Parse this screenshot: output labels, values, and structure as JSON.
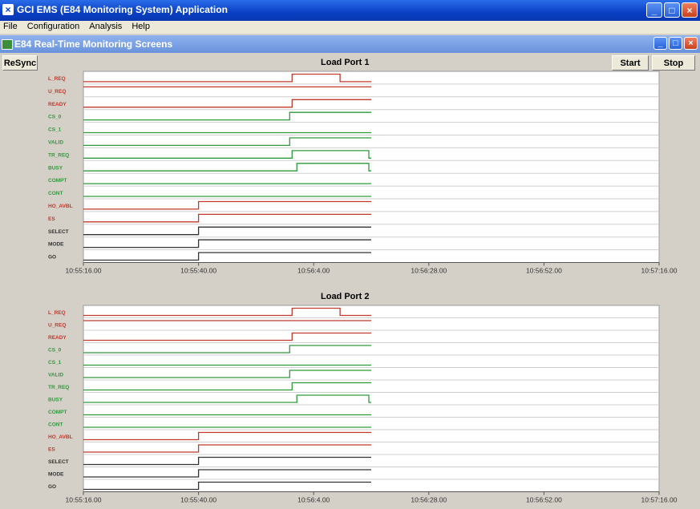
{
  "app": {
    "title": "GCI EMS (E84 Monitoring System) Application",
    "menu": [
      "File",
      "Configuration",
      "Analysis",
      "Help"
    ]
  },
  "child_window": {
    "title": "E84 Real-Time Monitoring Screens"
  },
  "toolbar": {
    "resync_label": "ReSync",
    "start_label": "Start",
    "stop_label": "Stop"
  },
  "colors": {
    "red": "#c0392b",
    "green": "#2e9a3a",
    "black": "#333333",
    "bg": "#d4d0c8"
  },
  "signals": [
    {
      "name": "L_REQ",
      "color": "red"
    },
    {
      "name": "U_REQ",
      "color": "red"
    },
    {
      "name": "READY",
      "color": "red"
    },
    {
      "name": "CS_0",
      "color": "green"
    },
    {
      "name": "CS_1",
      "color": "green"
    },
    {
      "name": "VALID",
      "color": "green"
    },
    {
      "name": "TR_REQ",
      "color": "green"
    },
    {
      "name": "BUSY",
      "color": "green"
    },
    {
      "name": "COMPT",
      "color": "green"
    },
    {
      "name": "CONT",
      "color": "green"
    },
    {
      "name": "HO_AVBL",
      "color": "red"
    },
    {
      "name": "ES",
      "color": "red"
    },
    {
      "name": "SELECT",
      "color": "black"
    },
    {
      "name": "MODE",
      "color": "black"
    },
    {
      "name": "GO",
      "color": "black"
    }
  ],
  "time_axis": {
    "ticks": [
      "10:55:16.00",
      "10:55:40.00",
      "10:56:4.00",
      "10:56:28.00",
      "10:56:52.00",
      "10:57:16.00"
    ],
    "start_seconds": 0,
    "end_seconds": 120,
    "data_end_seconds": 60
  },
  "chart_data": [
    {
      "type": "timing",
      "title": "Load Port 1",
      "x_range": [
        "10:55:16.00",
        "10:57:16.00"
      ],
      "series": [
        {
          "name": "L_REQ",
          "transitions": [
            [
              0,
              0
            ],
            [
              43.5,
              1
            ],
            [
              53.5,
              0
            ]
          ]
        },
        {
          "name": "U_REQ",
          "transitions": [
            [
              0,
              1
            ]
          ]
        },
        {
          "name": "READY",
          "transitions": [
            [
              0,
              0
            ],
            [
              43.5,
              1
            ]
          ]
        },
        {
          "name": "CS_0",
          "transitions": [
            [
              0,
              0
            ],
            [
              43,
              1
            ]
          ]
        },
        {
          "name": "CS_1",
          "transitions": [
            [
              0,
              0
            ]
          ]
        },
        {
          "name": "VALID",
          "transitions": [
            [
              0,
              0
            ],
            [
              43,
              1
            ]
          ]
        },
        {
          "name": "TR_REQ",
          "transitions": [
            [
              0,
              0
            ],
            [
              43.5,
              1
            ],
            [
              59.5,
              0
            ]
          ]
        },
        {
          "name": "BUSY",
          "transitions": [
            [
              0,
              0
            ],
            [
              44.5,
              1
            ],
            [
              59.5,
              0
            ]
          ]
        },
        {
          "name": "COMPT",
          "transitions": [
            [
              0,
              0
            ]
          ]
        },
        {
          "name": "CONT",
          "transitions": [
            [
              0,
              0
            ]
          ]
        },
        {
          "name": "HO_AVBL",
          "transitions": [
            [
              0,
              0
            ],
            [
              24,
              1
            ]
          ]
        },
        {
          "name": "ES",
          "transitions": [
            [
              0,
              0
            ],
            [
              24,
              1
            ]
          ]
        },
        {
          "name": "SELECT",
          "transitions": [
            [
              0,
              0
            ],
            [
              24,
              1
            ]
          ]
        },
        {
          "name": "MODE",
          "transitions": [
            [
              0,
              0
            ],
            [
              24,
              1
            ]
          ]
        },
        {
          "name": "GO",
          "transitions": [
            [
              0,
              0
            ],
            [
              24,
              1
            ]
          ]
        }
      ]
    },
    {
      "type": "timing",
      "title": "Load Port 2",
      "x_range": [
        "10:55:16.00",
        "10:57:16.00"
      ],
      "series": [
        {
          "name": "L_REQ",
          "transitions": [
            [
              0,
              0
            ],
            [
              43.5,
              1
            ],
            [
              53.5,
              0
            ]
          ]
        },
        {
          "name": "U_REQ",
          "transitions": [
            [
              0,
              1
            ]
          ]
        },
        {
          "name": "READY",
          "transitions": [
            [
              0,
              0
            ],
            [
              43.5,
              1
            ]
          ]
        },
        {
          "name": "CS_0",
          "transitions": [
            [
              0,
              0
            ],
            [
              43,
              1
            ]
          ]
        },
        {
          "name": "CS_1",
          "transitions": [
            [
              0,
              0
            ]
          ]
        },
        {
          "name": "VALID",
          "transitions": [
            [
              0,
              0
            ],
            [
              43,
              1
            ]
          ]
        },
        {
          "name": "TR_REQ",
          "transitions": [
            [
              0,
              0
            ],
            [
              43.5,
              1
            ]
          ]
        },
        {
          "name": "BUSY",
          "transitions": [
            [
              0,
              0
            ],
            [
              44.5,
              1
            ],
            [
              59.5,
              0
            ]
          ]
        },
        {
          "name": "COMPT",
          "transitions": [
            [
              0,
              0
            ]
          ]
        },
        {
          "name": "CONT",
          "transitions": [
            [
              0,
              0
            ]
          ]
        },
        {
          "name": "HO_AVBL",
          "transitions": [
            [
              0,
              0
            ],
            [
              24,
              1
            ]
          ]
        },
        {
          "name": "ES",
          "transitions": [
            [
              0,
              0
            ],
            [
              24,
              1
            ]
          ]
        },
        {
          "name": "SELECT",
          "transitions": [
            [
              0,
              0
            ],
            [
              24,
              1
            ]
          ]
        },
        {
          "name": "MODE",
          "transitions": [
            [
              0,
              0
            ],
            [
              24,
              1
            ]
          ]
        },
        {
          "name": "GO",
          "transitions": [
            [
              0,
              0
            ],
            [
              24,
              1
            ]
          ]
        }
      ]
    }
  ]
}
